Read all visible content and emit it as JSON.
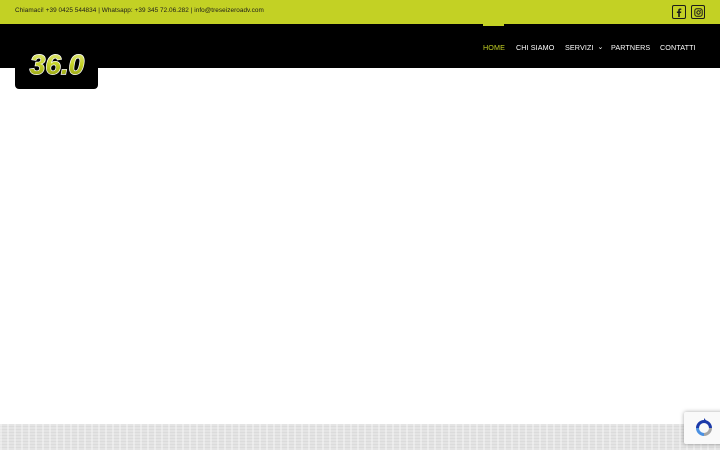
{
  "topbar": {
    "contact_text": "Chiamaci! +39 0425 544834 | Whatsapp: +39 345 72.06.282  |  info@treseizeroadv.com",
    "social": [
      {
        "icon": "facebook-icon"
      },
      {
        "icon": "instagram-icon"
      }
    ]
  },
  "logo": {
    "text": "36.0"
  },
  "nav": {
    "items": [
      {
        "label": "HOME",
        "active": true
      },
      {
        "label": "CHI SIAMO",
        "active": false
      },
      {
        "label": "SERVIZI",
        "active": false,
        "has_dropdown": true
      },
      {
        "label": "PARTNERS",
        "active": false
      },
      {
        "label": "CONTATTI",
        "active": false
      }
    ]
  },
  "colors": {
    "accent": "#c3d124",
    "navbar": "#000000",
    "footer": "#e4e4e4"
  },
  "recaptcha": {
    "icon": "recaptcha-icon"
  }
}
